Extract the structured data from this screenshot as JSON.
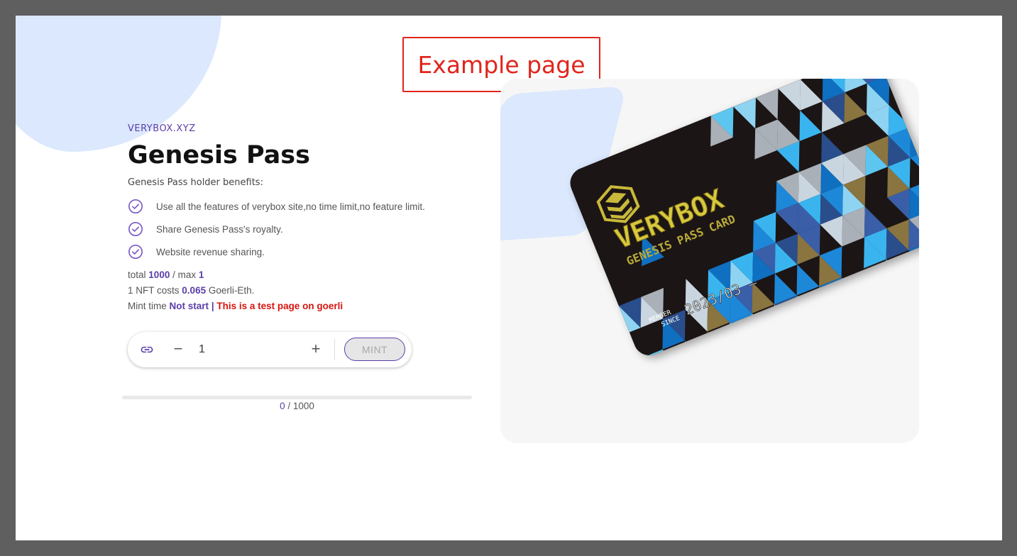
{
  "annotation": {
    "text": "Example page"
  },
  "brand": "VERYBOX.XYZ",
  "title": "Genesis Pass",
  "benefits_heading": "Genesis Pass holder benefits:",
  "benefits": [
    "Use all the features of verybox site,no time limit,no feature limit.",
    "Share Genesis Pass's royalty.",
    "Website revenue sharing."
  ],
  "stats": {
    "total_label": "total",
    "total": "1000",
    "max_sep": "/ max",
    "max": "1",
    "cost_prefix": "1 NFT costs",
    "cost": "0.065",
    "cost_unit": "Goerli-Eth.",
    "mint_time_label": "Mint time",
    "mint_status": "Not start",
    "separator": "|",
    "test_notice": "This is a test page on goerli"
  },
  "mint_bar": {
    "quantity": "1",
    "minus_label": "−",
    "plus_label": "+",
    "mint_label": "MINT"
  },
  "progress": {
    "minted": "0",
    "sep": "/",
    "total": "1000",
    "fraction": 0
  },
  "card": {
    "logo_text": "VERYBOX",
    "subtitle": "GENESIS PASS CARD",
    "member_label_1": "MEMBER",
    "member_label_2": "SINCE",
    "member_date": "2023/03 —"
  },
  "colors": {
    "accent": "#5b3ea8",
    "warning": "#d5150e",
    "blob": "#dbe8fd",
    "panel": "#f6f6f6"
  },
  "icons": {
    "benefit": "check-circle-icon",
    "link": "link-icon",
    "card_logo": "cube-logo-icon"
  }
}
